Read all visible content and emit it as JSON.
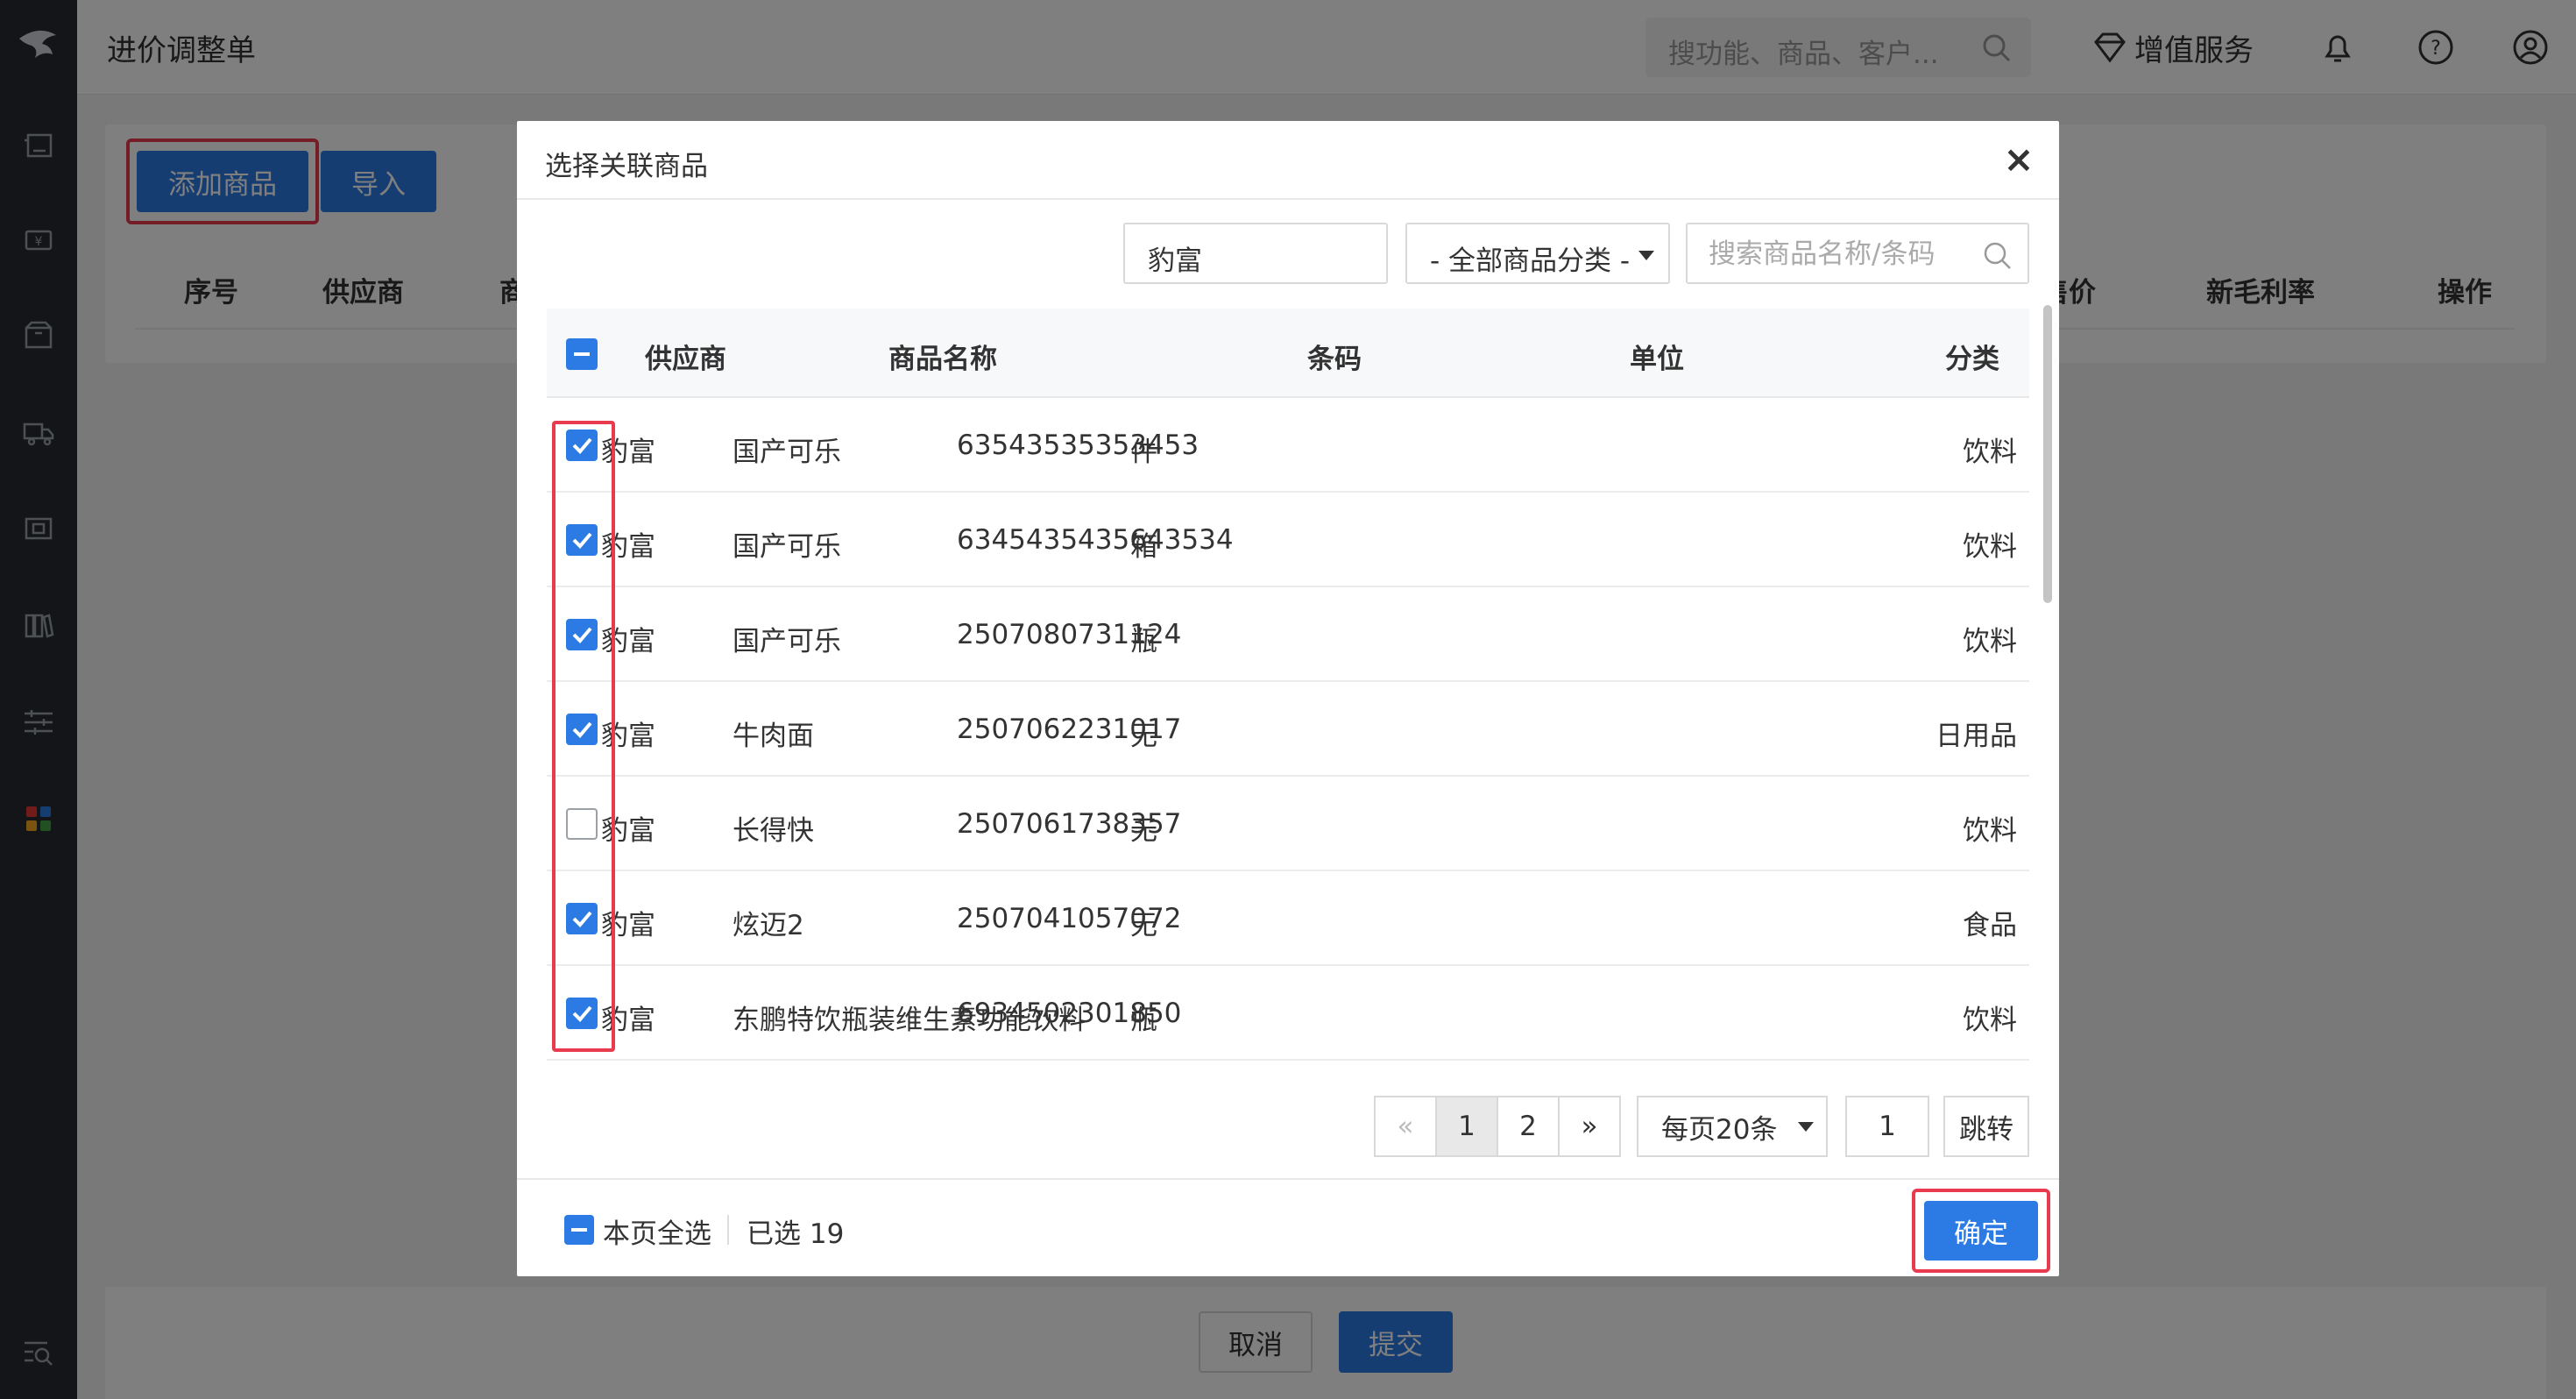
{
  "header": {
    "page_title": "进价调整单",
    "search_placeholder": "搜功能、商品、客户...",
    "vip_label": "增值服务"
  },
  "page": {
    "add_button": "添加商品",
    "import_button": "导入",
    "columns": [
      "序号",
      "供应商",
      "商",
      "售价",
      "新毛利率",
      "操作"
    ],
    "cancel_button": "取消",
    "submit_button": "提交"
  },
  "modal": {
    "title": "选择关联商品",
    "close_label": "×",
    "supplier_filter": "豹富",
    "category_filter": "- 全部商品分类 -",
    "search_placeholder": "搜索商品名称/条码",
    "columns": {
      "supplier": "供应商",
      "name": "商品名称",
      "barcode": "条码",
      "unit": "单位",
      "category": "分类"
    },
    "rows": [
      {
        "checked": true,
        "supplier": "豹富",
        "name": "国产可乐",
        "barcode": "63543535353453",
        "unit": "件",
        "category": "饮料"
      },
      {
        "checked": true,
        "supplier": "豹富",
        "name": "国产可乐",
        "barcode": "6345435435643534",
        "unit": "箱",
        "category": "饮料"
      },
      {
        "checked": true,
        "supplier": "豹富",
        "name": "国产可乐",
        "barcode": "2507080731124",
        "unit": "瓶",
        "category": "饮料"
      },
      {
        "checked": true,
        "supplier": "豹富",
        "name": "牛肉面",
        "barcode": "2507062231017",
        "unit": "无",
        "category": "日用品"
      },
      {
        "checked": false,
        "supplier": "豹富",
        "name": "长得快",
        "barcode": "2507061738357",
        "unit": "无",
        "category": "饮料"
      },
      {
        "checked": true,
        "supplier": "豹富",
        "name": "炫迈2",
        "barcode": "2507041057072",
        "unit": "无",
        "category": "食品"
      },
      {
        "checked": true,
        "supplier": "豹富",
        "name": "东鹏特饮瓶装维生素功能饮料",
        "barcode": "6934502301850",
        "unit": "瓶",
        "category": "饮料"
      }
    ],
    "pagination": {
      "prev": "«",
      "pages": [
        "1",
        "2"
      ],
      "current_page": "1",
      "next": "»",
      "page_size": "每页20条",
      "jump_value": "1",
      "jump_button": "跳转"
    },
    "footer": {
      "select_page_all": "本页全选",
      "selected_count": "已选 19",
      "confirm_button": "确定"
    }
  },
  "colors": {
    "primary": "#2c7be5",
    "highlight": "#e93b4e",
    "sidebar_bg": "#262a30"
  }
}
